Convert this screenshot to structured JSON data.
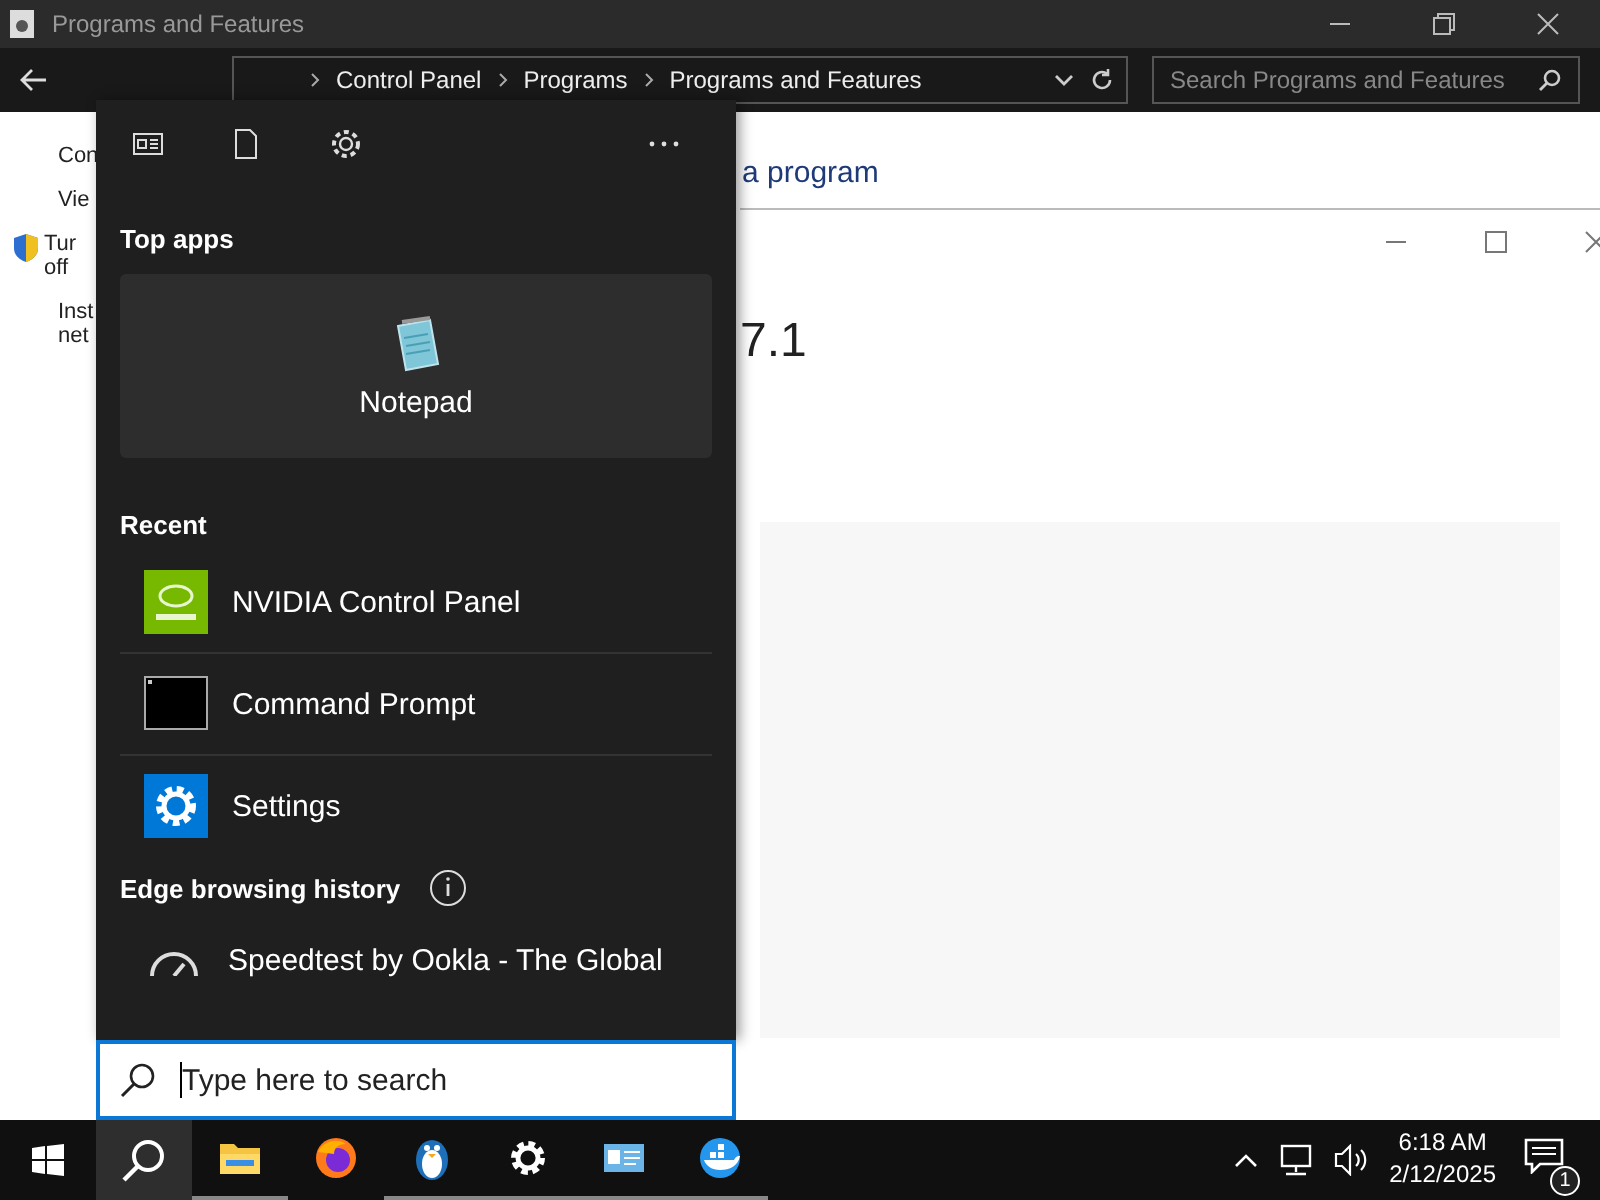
{
  "window": {
    "title": "Programs and Features",
    "breadcrumbs": [
      "Control Panel",
      "Programs",
      "Programs and Features"
    ],
    "search": {
      "placeholder": "Search Programs and Features"
    }
  },
  "sidebar": {
    "items": [
      {
        "lines": [
          "Con"
        ],
        "shield": false
      },
      {
        "lines": [
          "Vie"
        ],
        "shield": false
      },
      {
        "lines": [
          "Tur",
          "off"
        ],
        "shield": true
      },
      {
        "lines": [
          "Inst",
          "net"
        ],
        "shield": false
      }
    ]
  },
  "content": {
    "link": "a program"
  },
  "dialog": {
    "heading": "7.1"
  },
  "start_panel": {
    "top_apps": {
      "heading": "Top apps",
      "app": "Notepad"
    },
    "recent": {
      "heading": "Recent",
      "items": [
        {
          "name": "NVIDIA Control Panel",
          "kind": "nvidia"
        },
        {
          "name": "Command Prompt",
          "kind": "terminal"
        },
        {
          "name": "Settings",
          "kind": "settings"
        }
      ]
    },
    "history": {
      "heading": "Edge browsing history",
      "items": [
        {
          "name": "Speedtest by Ookla - The Global"
        }
      ]
    },
    "search": {
      "placeholder": "Type here to search"
    }
  },
  "taskbar": {
    "apps": [
      {
        "kind": "folder",
        "running": true
      },
      {
        "kind": "firefox",
        "running": false
      },
      {
        "kind": "penguin",
        "running": true
      },
      {
        "kind": "gear",
        "running": true
      },
      {
        "kind": "card",
        "running": true
      },
      {
        "kind": "whale",
        "running": true
      }
    ],
    "time": "6:18 AM",
    "date": "2/12/2025",
    "notifications": "1"
  }
}
